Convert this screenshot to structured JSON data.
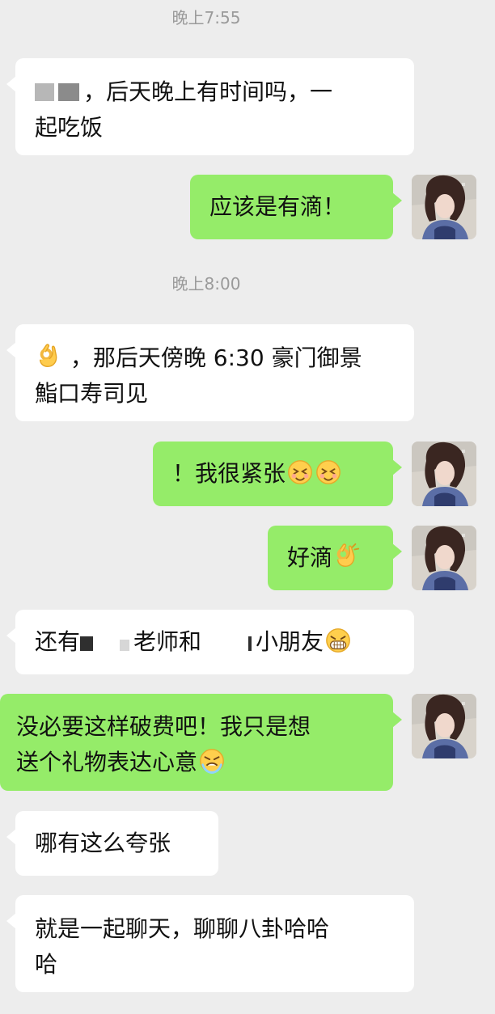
{
  "timestamps": [
    "晚上7:55",
    "晚上8:00"
  ],
  "messages": [
    {
      "side": "in",
      "text_1": "，后天晚上有时间吗，一",
      "text_2": "起吃饭"
    },
    {
      "side": "out",
      "text": "应该是有滴！"
    },
    {
      "side": "in",
      "text_1": "，那后天傍晚 6:30 豪门御景",
      "text_2": "鮨口寿司见"
    },
    {
      "side": "out",
      "text": "！我很紧张"
    },
    {
      "side": "out",
      "text": "好滴"
    },
    {
      "side": "in",
      "text_1": "还有",
      "text_2": "老师和",
      "text_3": "小朋友"
    },
    {
      "side": "out",
      "text_1": "没必要这样破费吧！我只是想",
      "text_2": "送个礼物表达心意"
    },
    {
      "side": "in",
      "text": "哪有这么夸张"
    },
    {
      "side": "in",
      "text_1": "就是一起聊天，聊聊八卦哈哈",
      "text_2": "哈"
    }
  ],
  "emoji_names": {
    "ok_hand": "ok-hand-emoji",
    "blush": "blush-emoji",
    "grin": "grin-emoji",
    "grimace": "grimace-emoji"
  },
  "colors": {
    "background": "#ededed",
    "incoming_bubble": "#ffffff",
    "outgoing_bubble": "#95ec69",
    "timestamp_text": "#9a9a9a",
    "message_text": "#111111"
  }
}
